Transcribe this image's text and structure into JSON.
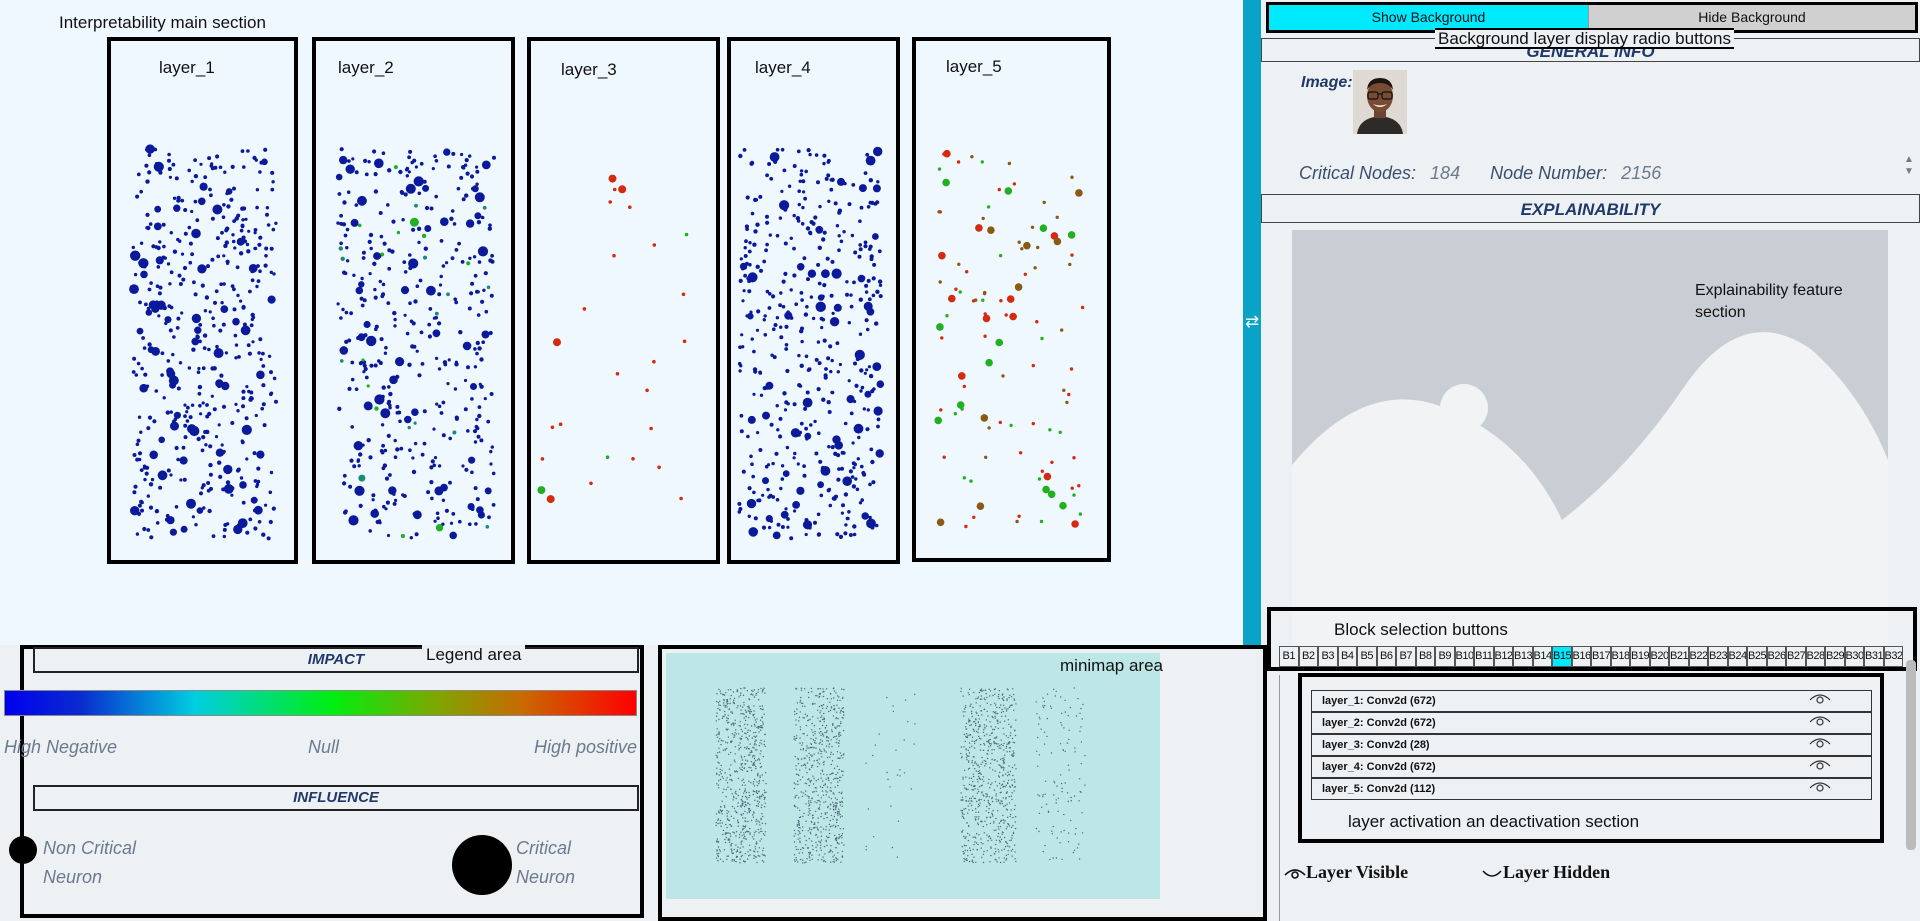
{
  "main": {
    "section_label": "Interpretability main section",
    "layers": [
      {
        "title": "layer_1"
      },
      {
        "title": "layer_2"
      },
      {
        "title": "layer_3"
      },
      {
        "title": "layer_4"
      },
      {
        "title": "layer_5"
      }
    ]
  },
  "background_toggle": {
    "show_label": "Show Background",
    "hide_label": "Hide Background",
    "selected": "show",
    "section_label": "Background layer display radio buttons"
  },
  "general_info": {
    "header": "GENERAL INFO",
    "image_label": "Image:",
    "critical_nodes_label": "Critical Nodes:",
    "critical_nodes_value": "184",
    "node_number_label": "Node Number:",
    "node_number_value": "2156"
  },
  "explainability": {
    "header": "EXPLAINABILITY",
    "section_label_line1": "Explainability feature",
    "section_label_line2": "section"
  },
  "blocks": {
    "section_label": "Block selection buttons",
    "items": [
      "B1",
      "B2",
      "B3",
      "B4",
      "B5",
      "B6",
      "B7",
      "B8",
      "B9",
      "B10",
      "B11",
      "B12",
      "B13",
      "B14",
      "B15",
      "B16",
      "B17",
      "B18",
      "B19",
      "B20",
      "B21",
      "B22",
      "B23",
      "B24",
      "B25",
      "B26",
      "B27",
      "B28",
      "B29",
      "B30",
      "B31",
      "B32"
    ],
    "active": "B15"
  },
  "layer_list": {
    "rows": [
      {
        "label": "layer_1: Conv2d (672)"
      },
      {
        "label": "layer_2: Conv2d (672)"
      },
      {
        "label": "layer_3: Conv2d (28)"
      },
      {
        "label": "layer_4: Conv2d (672)"
      },
      {
        "label": "layer_5: Conv2d (112)"
      }
    ],
    "section_label": "layer activation an deactivation section",
    "visible_legend": "Layer Visible",
    "hidden_legend": "Layer Hidden"
  },
  "legend": {
    "section_label": "Legend area",
    "impact_header": "IMPACT",
    "high_negative": "High Negative",
    "null_label": "Null",
    "high_positive": "High positive",
    "influence_header": "INFLUENCE",
    "non_critical_line1": "Non Critical",
    "non_critical_line2": "Neuron",
    "critical_line1": "Critical",
    "critical_line2": "Neuron"
  },
  "minimap": {
    "section_label": "minimap area"
  },
  "colors": {
    "accent": "#00eaff",
    "divider": "#0aa3c7",
    "header_text": "#1f3a6a",
    "neuron_blue": "#0b1a9a",
    "neuron_red": "#d42a10",
    "neuron_green": "#22b020"
  }
}
